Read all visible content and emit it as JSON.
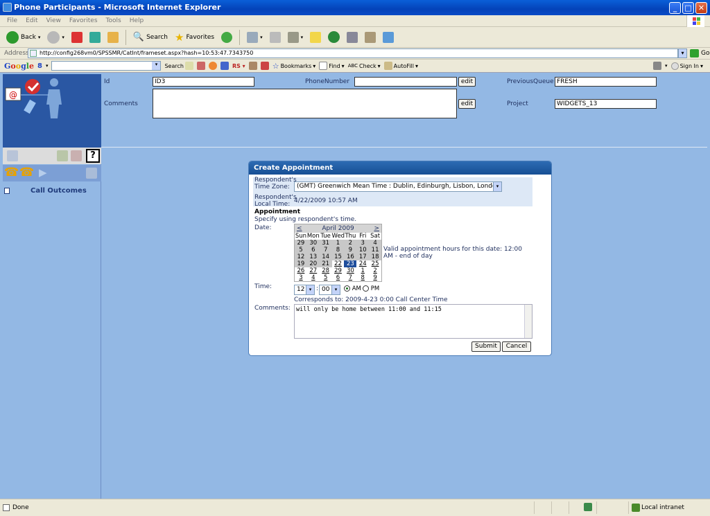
{
  "window": {
    "title": "Phone Participants - Microsoft Internet Explorer"
  },
  "menu": [
    "File",
    "Edit",
    "View",
    "Favorites",
    "Tools",
    "Help"
  ],
  "toolbar": {
    "back": "Back",
    "search": "Search",
    "favorites": "Favorites"
  },
  "address": {
    "label": "Address",
    "url": "http://config268vm0/SPSSMR/CatInt/frameset.aspx?hash=10:53:47.7343750",
    "go": "Go"
  },
  "google_bar": {
    "logo": "Google",
    "g8": "8",
    "search": "Search",
    "rs": "RS",
    "bookmarks": "Bookmarks",
    "find": "Find",
    "check": "Check",
    "autofill": "AutoFill",
    "signin": "Sign In"
  },
  "header": {
    "id_label": "Id",
    "id_value": "ID3",
    "phone_label": "PhoneNumber",
    "phone_value": "",
    "edit_label": "edit",
    "prevq_label": "PreviousQueue",
    "prevq_value": "FRESH",
    "comments_label": "Comments",
    "project_label": "Project",
    "project_value": "WIDGETS_13"
  },
  "left": {
    "help": "?",
    "call_outcomes": "Call Outcomes"
  },
  "dialog": {
    "title": "Create Appointment",
    "tz_label_1": "Respondent's",
    "tz_label_2": "Time Zone:",
    "tz_value": "(GMT) Greenwich Mean Time : Dublin, Edinburgh, Lisbon, London",
    "lt_label_1": "Respondent's",
    "lt_label_2": "Local Time:",
    "lt_value": "4/22/2009 10:57 AM",
    "appt_heading": "Appointment",
    "appt_hint": "Specify using respondent's time.",
    "date_label": "Date:",
    "cal_prev": "<",
    "cal_month": "April 2009",
    "cal_next": ">",
    "cal_dows": [
      "Sun",
      "Mon",
      "Tue",
      "Wed",
      "Thu",
      "Fri",
      "Sat"
    ],
    "cal_weeks": [
      [
        "29",
        "30",
        "31",
        "1",
        "2",
        "3",
        "4"
      ],
      [
        "5",
        "6",
        "7",
        "8",
        "9",
        "10",
        "11"
      ],
      [
        "12",
        "13",
        "14",
        "15",
        "16",
        "17",
        "18"
      ],
      [
        "19",
        "20",
        "21",
        "22",
        "23",
        "24",
        "25"
      ],
      [
        "26",
        "27",
        "28",
        "29",
        "30",
        "1",
        "2"
      ],
      [
        "3",
        "4",
        "5",
        "6",
        "7",
        "8",
        "9"
      ]
    ],
    "cal_selected": "23",
    "valid_hours": "Valid appointment hours for this date: 12:00 AM - end of day",
    "time_label": "Time:",
    "hour": "12",
    "minute": "00",
    "am": "AM",
    "pm": "PM",
    "colon": ":",
    "corresponds": "Corresponds to: 2009-4-23 0:00 Call Center Time",
    "comments_label": "Comments:",
    "comments_value": "will only be home between 11:00 and 11:15",
    "submit": "Submit",
    "cancel": "Cancel"
  },
  "status": {
    "done": "Done",
    "zone": "Local intranet"
  }
}
